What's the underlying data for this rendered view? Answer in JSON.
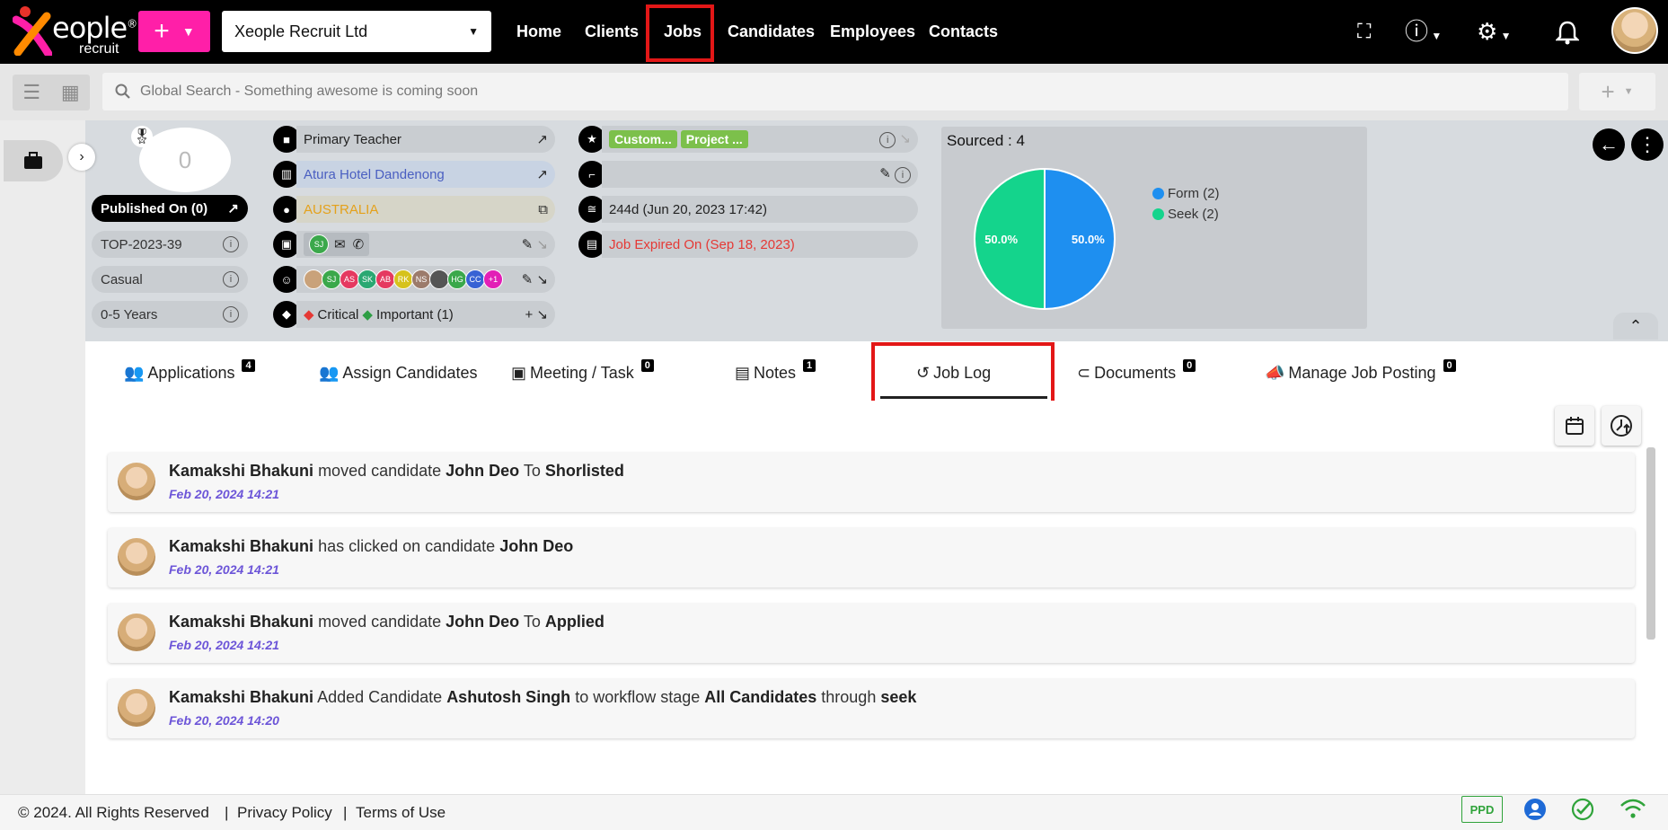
{
  "brand": {
    "name": "eople",
    "sub": "recruit",
    "reg": "®"
  },
  "topnav": {
    "company": "Xeople Recruit Ltd",
    "items": [
      "Home",
      "Clients",
      "Jobs",
      "Candidates",
      "Employees",
      "Contacts"
    ],
    "active": "Jobs"
  },
  "search": {
    "placeholder": "Global Search - Something awesome is coming soon"
  },
  "job": {
    "score": "0",
    "published": "Published On (0)",
    "ref": "TOP-2023-39",
    "type": "Casual",
    "experience": "0-5 Years",
    "title": "Primary Teacher",
    "client": "Atura Hotel Dandenong",
    "location": "AUSTRALIA",
    "consultant_initials": "SJ",
    "team_initials": [
      "SJ",
      "AS",
      "SK",
      "AB",
      "RK",
      "NS",
      "",
      "HG",
      "CC"
    ],
    "team_more": "+1",
    "tags": [
      {
        "label": "Critical",
        "color": "#e53935"
      },
      {
        "label": "Important (1)",
        "color": "#2e9e45"
      }
    ],
    "labels": [
      "Custom...",
      "Project ..."
    ],
    "age": "244d (Jun 20, 2023 17:42)",
    "expired": "Job Expired On (Sep 18, 2023)"
  },
  "chart_data": {
    "type": "pie",
    "title": "Sourced : 4",
    "labels": [
      "Form",
      "Seek"
    ],
    "values": [
      2,
      2
    ],
    "legend": [
      "Form (2)",
      "Seek (2)"
    ],
    "slice_labels": [
      "50.0%",
      "50.0%"
    ],
    "colors": [
      "#1e8ff0",
      "#14d48c"
    ],
    "legend_position": "right"
  },
  "tabs": [
    {
      "label": "Applications",
      "badge": "4"
    },
    {
      "label": "Assign Candidates",
      "badge": ""
    },
    {
      "label": "Meeting / Task",
      "badge": "0"
    },
    {
      "label": "Notes",
      "badge": "1"
    },
    {
      "label": "Job Log",
      "badge": ""
    },
    {
      "label": "Documents",
      "badge": "0"
    },
    {
      "label": "Manage Job Posting",
      "badge": "0"
    }
  ],
  "active_tab": "Job Log",
  "logs": [
    {
      "user": "Kamakshi Bhakuni",
      "a1": " moved candidate ",
      "o1": "John Deo",
      "a2": " To ",
      "o2": "Shorlisted",
      "a3": "",
      "o3": "",
      "time": "Feb 20, 2024 14:21"
    },
    {
      "user": "Kamakshi Bhakuni",
      "a1": " has clicked on candidate ",
      "o1": "John Deo",
      "a2": "",
      "o2": "",
      "a3": "",
      "o3": "",
      "time": "Feb 20, 2024 14:21"
    },
    {
      "user": "Kamakshi Bhakuni",
      "a1": " moved candidate ",
      "o1": "John Deo",
      "a2": " To ",
      "o2": "Applied",
      "a3": "",
      "o3": "",
      "time": "Feb 20, 2024 14:21"
    },
    {
      "user": "Kamakshi Bhakuni",
      "a1": " Added Candidate ",
      "o1": "Ashutosh Singh",
      "a2": " to workflow stage ",
      "o2": "All Candidates",
      "a3": " through ",
      "o3": "seek",
      "time": "Feb 20, 2024 14:20"
    }
  ],
  "footer": {
    "copyright": "© 2024. All Rights Reserved",
    "sep": "|",
    "privacy": "Privacy Policy",
    "terms": "Terms of Use",
    "ppd": "PPD"
  }
}
